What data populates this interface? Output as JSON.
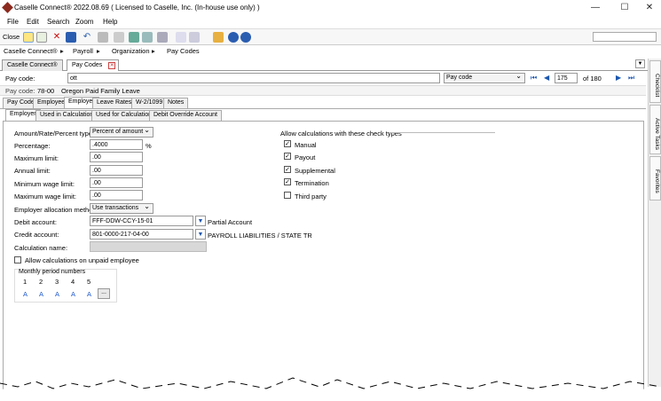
{
  "window": {
    "title": "Caselle Connect® 2022.08.69   ( Licensed to Caselle, Inc. (In-house use only) )",
    "minimize": "—",
    "maximize": "☐",
    "close": "✕"
  },
  "menu": [
    "File",
    "Edit",
    "Search",
    "Zoom",
    "Help"
  ],
  "toolbar": {
    "close_label": "Close"
  },
  "breadcrumb": [
    "Caselle Connect®",
    "Payroll",
    "Organization",
    "Pay Codes"
  ],
  "doc_tabs": [
    "Caselle Connect®",
    "Pay Codes"
  ],
  "side_tabs": [
    "Checklist",
    "Active Tasks",
    "Favorites"
  ],
  "search": {
    "label": "Pay code:",
    "value": "ott",
    "field_select": "Pay code",
    "record": "175",
    "of_total": "of 180"
  },
  "record_header": {
    "label": "Pay code:",
    "code": "78-00",
    "name": "Oregon Paid Family Leave"
  },
  "main_tabs": [
    "Pay Code",
    "Employee",
    "Employer",
    "Leave Rates",
    "W-2/1099",
    "Notes"
  ],
  "sub_tabs": [
    "Employer",
    "Used in Calculations",
    "Used for Calculation",
    "Debit Override Account"
  ],
  "form": {
    "amount_type_label": "Amount/Rate/Percent type:",
    "amount_type": "Percent of amount",
    "percentage_label": "Percentage:",
    "percentage": ".4000",
    "percent_sign": "%",
    "max_limit_label": "Maximum limit:",
    "max_limit": ".00",
    "annual_limit_label": "Annual limit:",
    "annual_limit": ".00",
    "min_wage_label": "Minimum wage limit:",
    "min_wage": ".00",
    "max_wage_label": "Maximum wage limit:",
    "max_wage": ".00",
    "alloc_label": "Employer allocation method:",
    "alloc": "Use transactions",
    "debit_label": "Debit account:",
    "debit": "FFF-DDW-CCY-15-01",
    "debit_desc": "Partial Account",
    "credit_label": "Credit account:",
    "credit": "801-0000-217-04-00",
    "credit_desc": "PAYROLL LIABILITIES / STATE TR",
    "calc_name_label": "Calculation name:",
    "unpaid_label": "Allow calculations on unpaid employee"
  },
  "monthly": {
    "title": "Monthly period numbers",
    "numbers": [
      "1",
      "2",
      "3",
      "4",
      "5"
    ],
    "values": [
      "A",
      "A",
      "A",
      "A",
      "A"
    ],
    "more": "..."
  },
  "check_types": {
    "title": "Allow calculations with these check types",
    "items": [
      {
        "label": "Manual",
        "checked": true
      },
      {
        "label": "Payout",
        "checked": true
      },
      {
        "label": "Supplemental",
        "checked": true
      },
      {
        "label": "Termination",
        "checked": true
      },
      {
        "label": "Third party",
        "checked": false
      }
    ]
  }
}
